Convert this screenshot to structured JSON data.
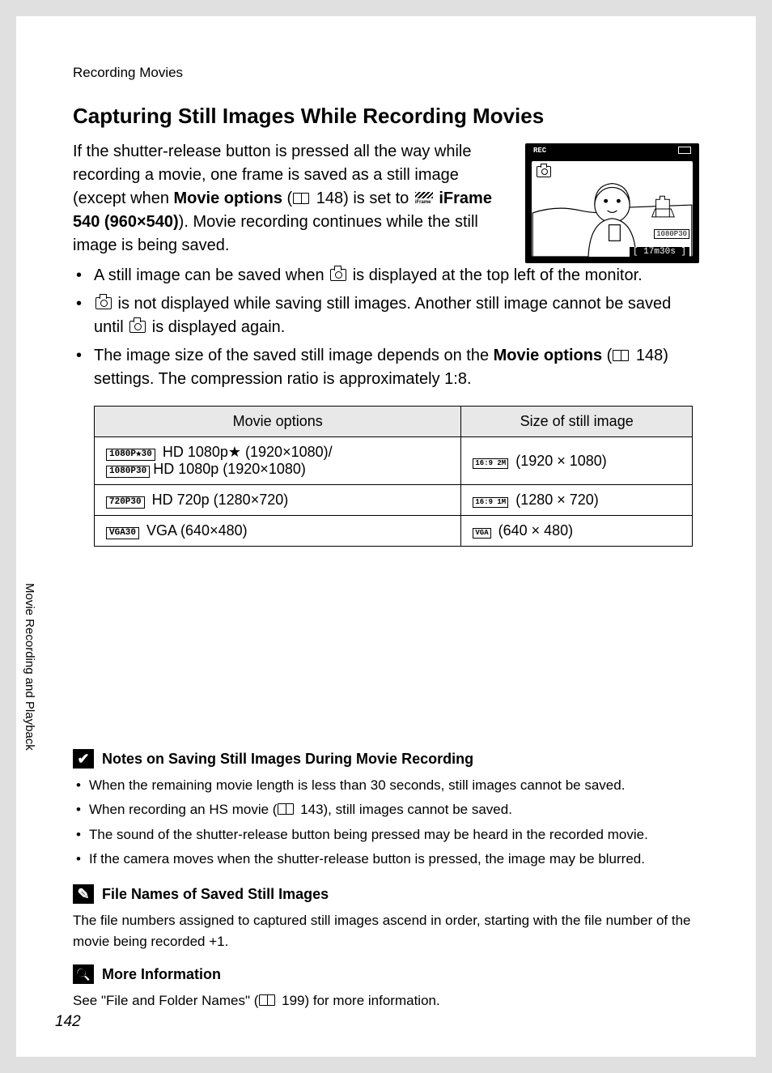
{
  "running_head": "Recording Movies",
  "heading": "Capturing Still Images While Recording Movies",
  "intro": {
    "p1a": "If the shutter-release button is pressed all the way while recording a movie, one frame is saved as a still image (except when ",
    "movie_options": "Movie options",
    "p1b": " (",
    "ref1": " 148) is set to ",
    "iframe": " iFrame 540 (960×540)",
    "p1c": "). Movie recording continues while the still image is being saved."
  },
  "bullets": {
    "b1a": "A still image can be saved when ",
    "b1b": " is displayed at the top left of the monitor.",
    "b2a": " is not displayed while saving still images. Another still image cannot be saved until ",
    "b2b": " is displayed again.",
    "b3a": "The image size of the saved still image depends on the ",
    "b3b": "Movie options",
    "b3c": " (",
    "b3ref": " 148) settings. The compression ratio is approximately 1:8."
  },
  "table": {
    "h1": "Movie options",
    "h2": "Size of still image",
    "r1c1_badge1": "1080P★30",
    "r1c1_t1": " HD 1080p★ (1920×1080)/",
    "r1c1_badge2": "1080P30",
    "r1c1_t2": "HD 1080p (1920×1080)",
    "r1c2_badge": "16:9\n2M",
    "r1c2": " (1920 × 1080)",
    "r2c1_badge": "720P30",
    "r2c1": " HD 720p (1280×720)",
    "r2c2_badge": "16:9\n1M",
    "r2c2": " (1280 × 720)",
    "r3c1_badge": "VGA30",
    "r3c1": " VGA (640×480)",
    "r3c2_badge": "VGA",
    "r3c2": " (640 × 480)"
  },
  "illus": {
    "rec": "REC",
    "time": "[   17m30s ]",
    "res": "1080P30"
  },
  "notes1": {
    "title": "Notes on Saving Still Images During Movie Recording",
    "n1": "When the remaining movie length is less than 30 seconds, still images cannot be saved.",
    "n2a": "When recording an HS movie (",
    "n2ref": " 143), still images cannot be saved.",
    "n3": "The sound of the shutter-release button being pressed may be heard in the recorded movie.",
    "n4": "If the camera moves when the shutter-release button is pressed, the image may be blurred."
  },
  "notes2": {
    "title": "File Names of Saved Still Images",
    "p": "The file numbers assigned to captured still images ascend in order, starting with the file number of the movie being recorded +1."
  },
  "notes3": {
    "title": "More Information",
    "pa": "See \"File and Folder Names\" (",
    "pref": " 199) for more information."
  },
  "side_tab": "Movie Recording and Playback",
  "page_num": "142"
}
